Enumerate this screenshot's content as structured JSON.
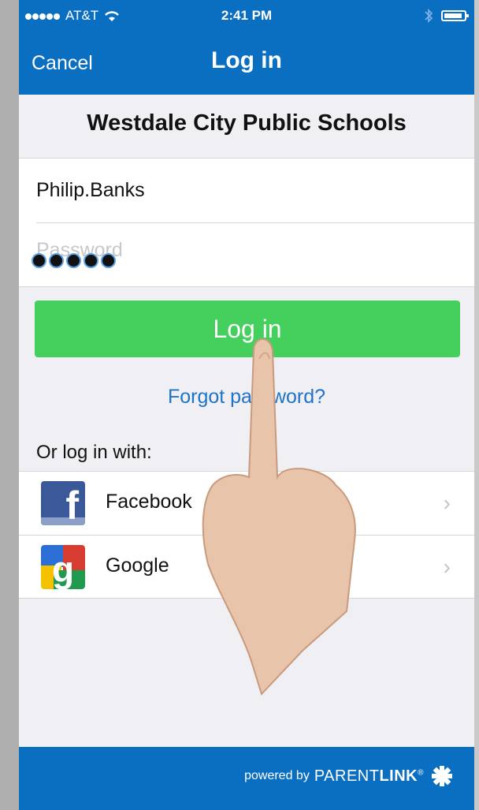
{
  "status_bar": {
    "carrier": "AT&T",
    "time": "2:41 PM"
  },
  "nav": {
    "cancel_label": "Cancel",
    "title": "Log in"
  },
  "school_name": "Westdale City Public Schools",
  "form": {
    "username_value": "Philip.Banks",
    "password_placeholder": "Password",
    "password_masked_length": 5
  },
  "login_button_label": "Log in",
  "forgot_password_label": "Forgot password?",
  "or_label": "Or log in with:",
  "social": [
    {
      "label": "Facebook",
      "icon": "facebook-icon"
    },
    {
      "label": "Google",
      "icon": "google-icon"
    }
  ],
  "footer": {
    "powered_label": "powered by",
    "brand_prefix": "PARENT",
    "brand_suffix": "LINK",
    "registered": "®"
  },
  "colors": {
    "nav_bg": "#0b6fc1",
    "login_button": "#45d05e",
    "link": "#1f74c6"
  }
}
